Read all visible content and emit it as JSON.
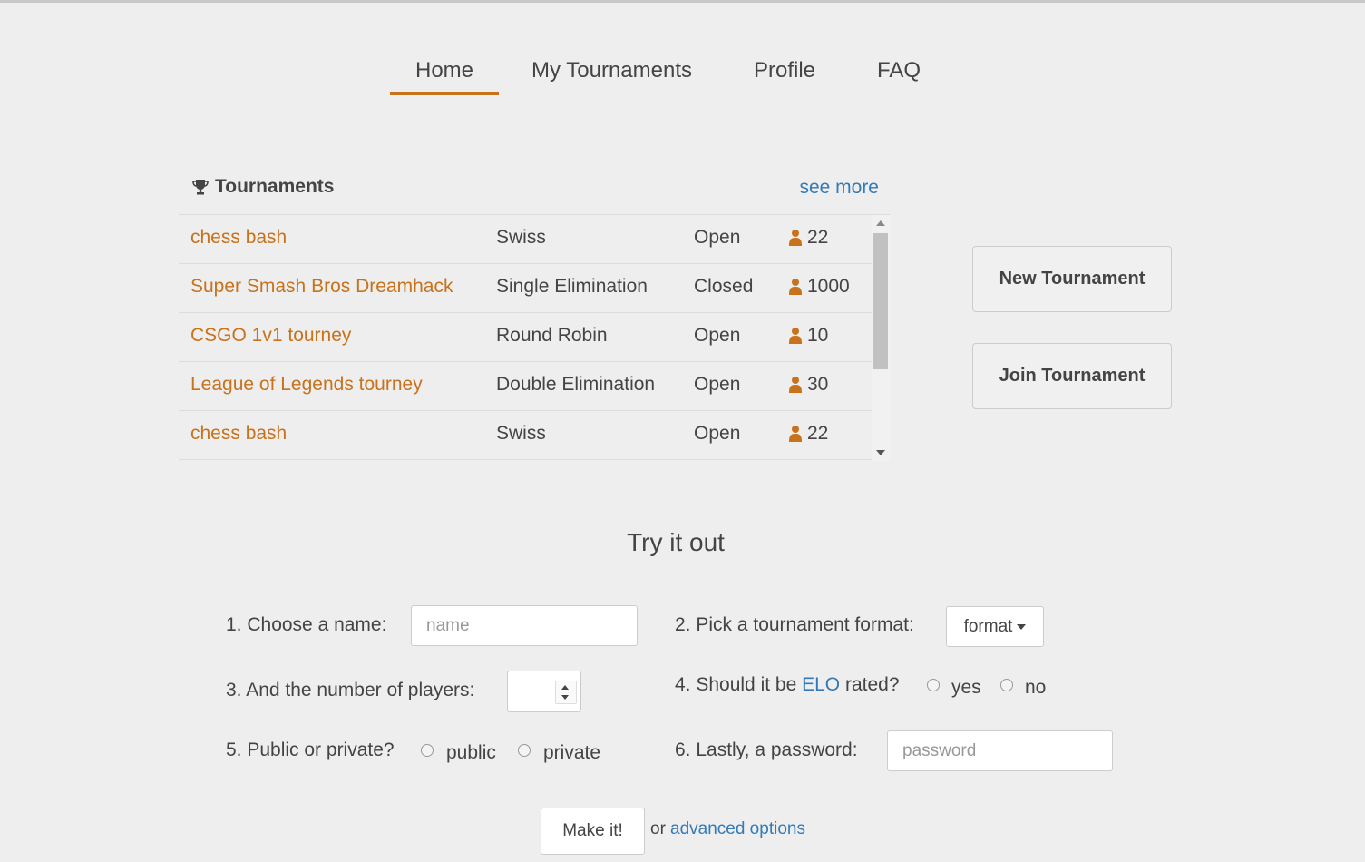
{
  "nav": {
    "items": [
      {
        "label": "Home",
        "active": true
      },
      {
        "label": "My Tournaments",
        "active": false
      },
      {
        "label": "Profile",
        "active": false
      },
      {
        "label": "FAQ",
        "active": false
      }
    ]
  },
  "tournaments": {
    "title": "Tournaments",
    "icon": "trophy-icon",
    "see_more": "see more",
    "rows": [
      {
        "name": "chess bash",
        "format": "Swiss",
        "status": "Open",
        "players": "22"
      },
      {
        "name": "Super Smash Bros Dreamhack",
        "format": "Single Elimination",
        "status": "Closed",
        "players": "1000"
      },
      {
        "name": "CSGO 1v1 tourney",
        "format": "Round Robin",
        "status": "Open",
        "players": "10"
      },
      {
        "name": "League of Legends tourney",
        "format": "Double Elimination",
        "status": "Open",
        "players": "30"
      },
      {
        "name": "chess bash",
        "format": "Swiss",
        "status": "Open",
        "players": "22"
      }
    ]
  },
  "actions": {
    "new_tournament": "New Tournament",
    "join_tournament": "Join Tournament"
  },
  "try_it": {
    "title": "Try it out",
    "step1_label": "1. Choose a name:",
    "name_placeholder": "name",
    "step2_label": "2. Pick a tournament format:",
    "format_button": "format",
    "step3_label": "3. And the number of players:",
    "step4_prefix": "4. Should it be",
    "step4_link": "ELO",
    "step4_suffix": "rated?",
    "yes_label": "yes",
    "no_label": "no",
    "step5_label": "5. Public or private?",
    "public_label": "public",
    "private_label": "private",
    "step6_label": "6. Lastly, a password:",
    "password_placeholder": "password",
    "make_button": "Make it!",
    "or_text": "or",
    "advanced_link": "advanced options"
  },
  "colors": {
    "accent": "#c8721b",
    "link": "#337ab7",
    "background": "#eeeeee"
  }
}
